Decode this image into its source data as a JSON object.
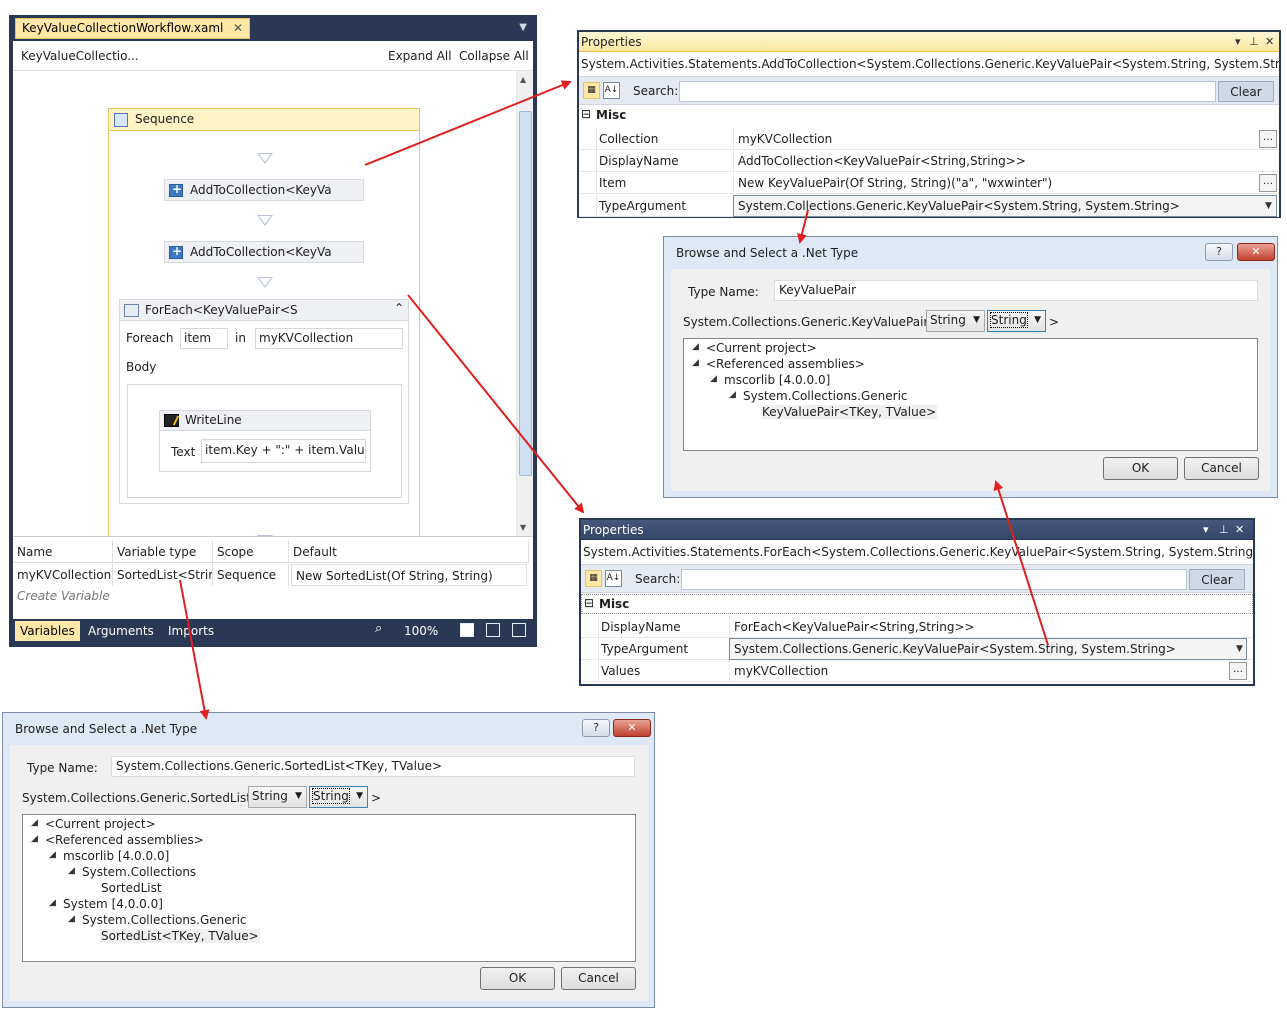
{
  "designer": {
    "tab_title": "KeyValueCollectionWorkflow.xaml",
    "tab_close": "✕",
    "breadcrumb": "KeyValueCollectio...",
    "expand_all": "Expand All",
    "collapse_all": "Collapse All",
    "sequence_title": "Sequence",
    "add1": "AddToCollection<KeyVa",
    "add2": "AddToCollection<KeyVa",
    "foreach_title": "ForEach<KeyValuePair<S",
    "foreach_label": "Foreach",
    "foreach_item": "item",
    "in_label": "in",
    "foreach_collection": "myKVCollection",
    "body_label": "Body",
    "writeline_title": "WriteLine",
    "text_label": "Text",
    "text_value": "item.Key + \":\" + item.Value",
    "variables": {
      "headers": [
        "Name",
        "Variable type",
        "Scope",
        "Default"
      ],
      "row": {
        "name": "myKVCollection",
        "type": "SortedList<String",
        "scope": "Sequence",
        "default": "New SortedList(Of String, String)"
      },
      "create": "Create Variable"
    },
    "bottom_tabs": [
      "Variables",
      "Arguments",
      "Imports"
    ],
    "zoom": "100%"
  },
  "props1": {
    "title": "Properties",
    "type_line": "System.Activities.Statements.AddToCollection<System.Collections.Generic.KeyValuePair<System.String, System.String>>",
    "search_label": "Search:",
    "clear": "Clear",
    "category": "Misc",
    "rows": [
      {
        "name": "Collection",
        "value": "myKVCollection"
      },
      {
        "name": "DisplayName",
        "value": "AddToCollection<KeyValuePair<String,String>>"
      },
      {
        "name": "Item",
        "value": "New KeyValuePair(Of String, String)(\"a\", \"wxwinter\")"
      },
      {
        "name": "TypeArgument",
        "value": "System.Collections.Generic.KeyValuePair<System.String, System.String>"
      }
    ]
  },
  "props2": {
    "title": "Properties",
    "type_line": "System.Activities.Statements.ForEach<System.Collections.Generic.KeyValuePair<System.String, System.String>>",
    "search_label": "Search:",
    "clear": "Clear",
    "category": "Misc",
    "rows": [
      {
        "name": "DisplayName",
        "value": "ForEach<KeyValuePair<String,String>>"
      },
      {
        "name": "TypeArgument",
        "value": "System.Collections.Generic.KeyValuePair<System.String, System.String>"
      },
      {
        "name": "Values",
        "value": "myKVCollection"
      }
    ]
  },
  "dialog1": {
    "title": "Browse and Select a .Net Type",
    "help": "?",
    "close": "✕",
    "type_name_label": "Type Name:",
    "type_name_value": "KeyValuePair",
    "generic_prefix": "System.Collections.Generic.KeyValuePair <",
    "generic_suffix": ">",
    "arg1": "String",
    "arg2": "String",
    "tree": [
      "<Current project>",
      "<Referenced assemblies>",
      "mscorlib [4.0.0.0]",
      "System.Collections.Generic",
      "KeyValuePair<TKey, TValue>"
    ],
    "ok": "OK",
    "cancel": "Cancel"
  },
  "dialog2": {
    "title": "Browse and Select a .Net Type",
    "help": "?",
    "close": "✕",
    "type_name_label": "Type Name:",
    "type_name_value": "System.Collections.Generic.SortedList<TKey, TValue>",
    "generic_prefix": "System.Collections.Generic.SortedList <",
    "generic_suffix": ">",
    "arg1": "String",
    "arg2": "String",
    "tree": [
      "<Current project>",
      "<Referenced assemblies>",
      "mscorlib [4.0.0.0]",
      "System.Collections",
      "SortedList",
      "System [4.0.0.0]",
      "System.Collections.Generic",
      "SortedList<TKey, TValue>"
    ],
    "ok": "OK",
    "cancel": "Cancel"
  },
  "colors": {
    "frame": "#293955",
    "tab_active": "#ffe8a6",
    "arrow": "#e02020"
  }
}
